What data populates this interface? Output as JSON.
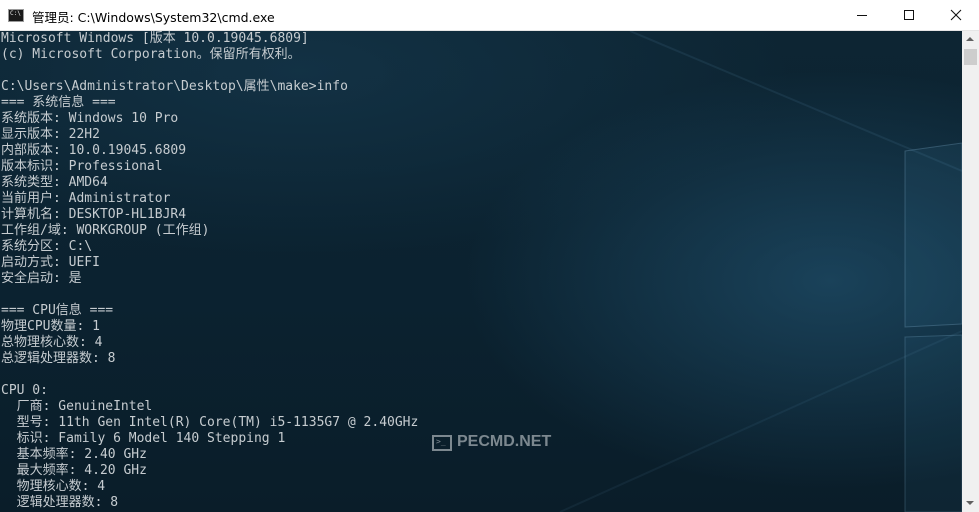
{
  "window": {
    "title": "管理员: C:\\Windows\\System32\\cmd.exe",
    "icon": "cmd-app-icon"
  },
  "controls": {
    "minimize_icon": "minimize-icon",
    "maximize_icon": "maximize-icon",
    "close_icon": "close-icon"
  },
  "console": {
    "lines": [
      "Microsoft Windows [版本 10.0.19045.6809]",
      "(c) Microsoft Corporation。保留所有权利。",
      "",
      "C:\\Users\\Administrator\\Desktop\\属性\\make>info",
      "=== 系统信息 ===",
      "系统版本: Windows 10 Pro",
      "显示版本: 22H2",
      "内部版本: 10.0.19045.6809",
      "版本标识: Professional",
      "系统类型: AMD64",
      "当前用户: Administrator",
      "计算机名: DESKTOP-HL1BJR4",
      "工作组/域: WORKGROUP (工作组)",
      "系统分区: C:\\",
      "启动方式: UEFI",
      "安全启动: 是",
      "",
      "=== CPU信息 ===",
      "物理CPU数量: 1",
      "总物理核心数: 4",
      "总逻辑处理器数: 8",
      "",
      "CPU 0:",
      "  厂商: GenuineIntel",
      "  型号: 11th Gen Intel(R) Core(TM) i5-1135G7 @ 2.40GHz",
      "  标识: Family 6 Model 140 Stepping 1",
      "  基本频率: 2.40 GHz",
      "  最大频率: 4.20 GHz",
      "  物理核心数: 4",
      "  逻辑处理器数: 8"
    ]
  },
  "watermark": {
    "text": "PECMD.NET",
    "icon": "terminal-icon"
  },
  "colors": {
    "console_text": "#c6ccd0",
    "console_background": "#0c2431",
    "titlebar": "#ffffff"
  }
}
